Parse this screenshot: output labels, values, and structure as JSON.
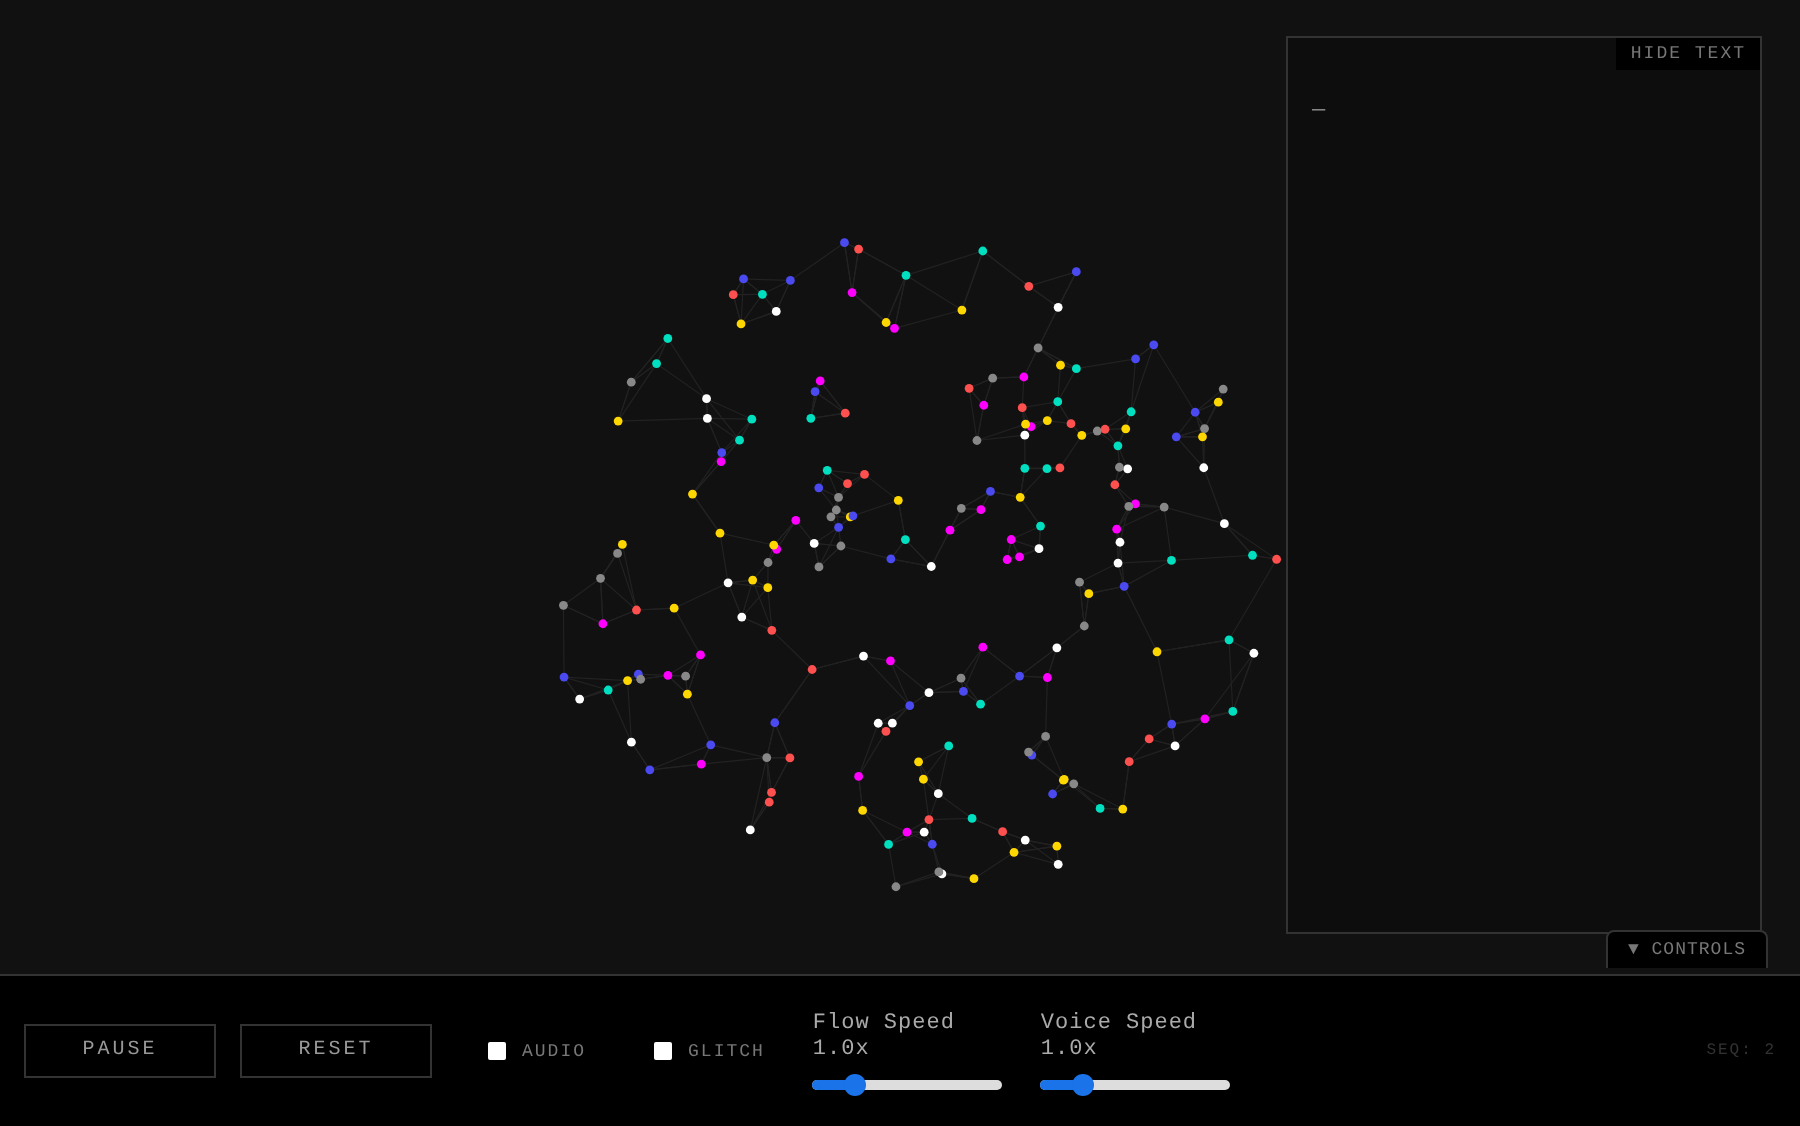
{
  "text_panel": {
    "hide_button": "HIDE TEXT",
    "content": "_"
  },
  "controls_toggle": {
    "label": "▼ CONTROLS",
    "expanded": true
  },
  "controls": {
    "buttons": [
      "PAUSE",
      "RESET"
    ],
    "toggles": [
      {
        "label": "AUDIO",
        "checked": false
      },
      {
        "label": "GLITCH",
        "checked": false
      }
    ],
    "sliders": [
      {
        "label": "Flow Speed",
        "reading": "1.0x",
        "level": 0.22
      },
      {
        "label": "Voice Speed",
        "reading": "1.0x",
        "level": 0.22
      }
    ],
    "sequence": "SEQ: 2"
  }
}
